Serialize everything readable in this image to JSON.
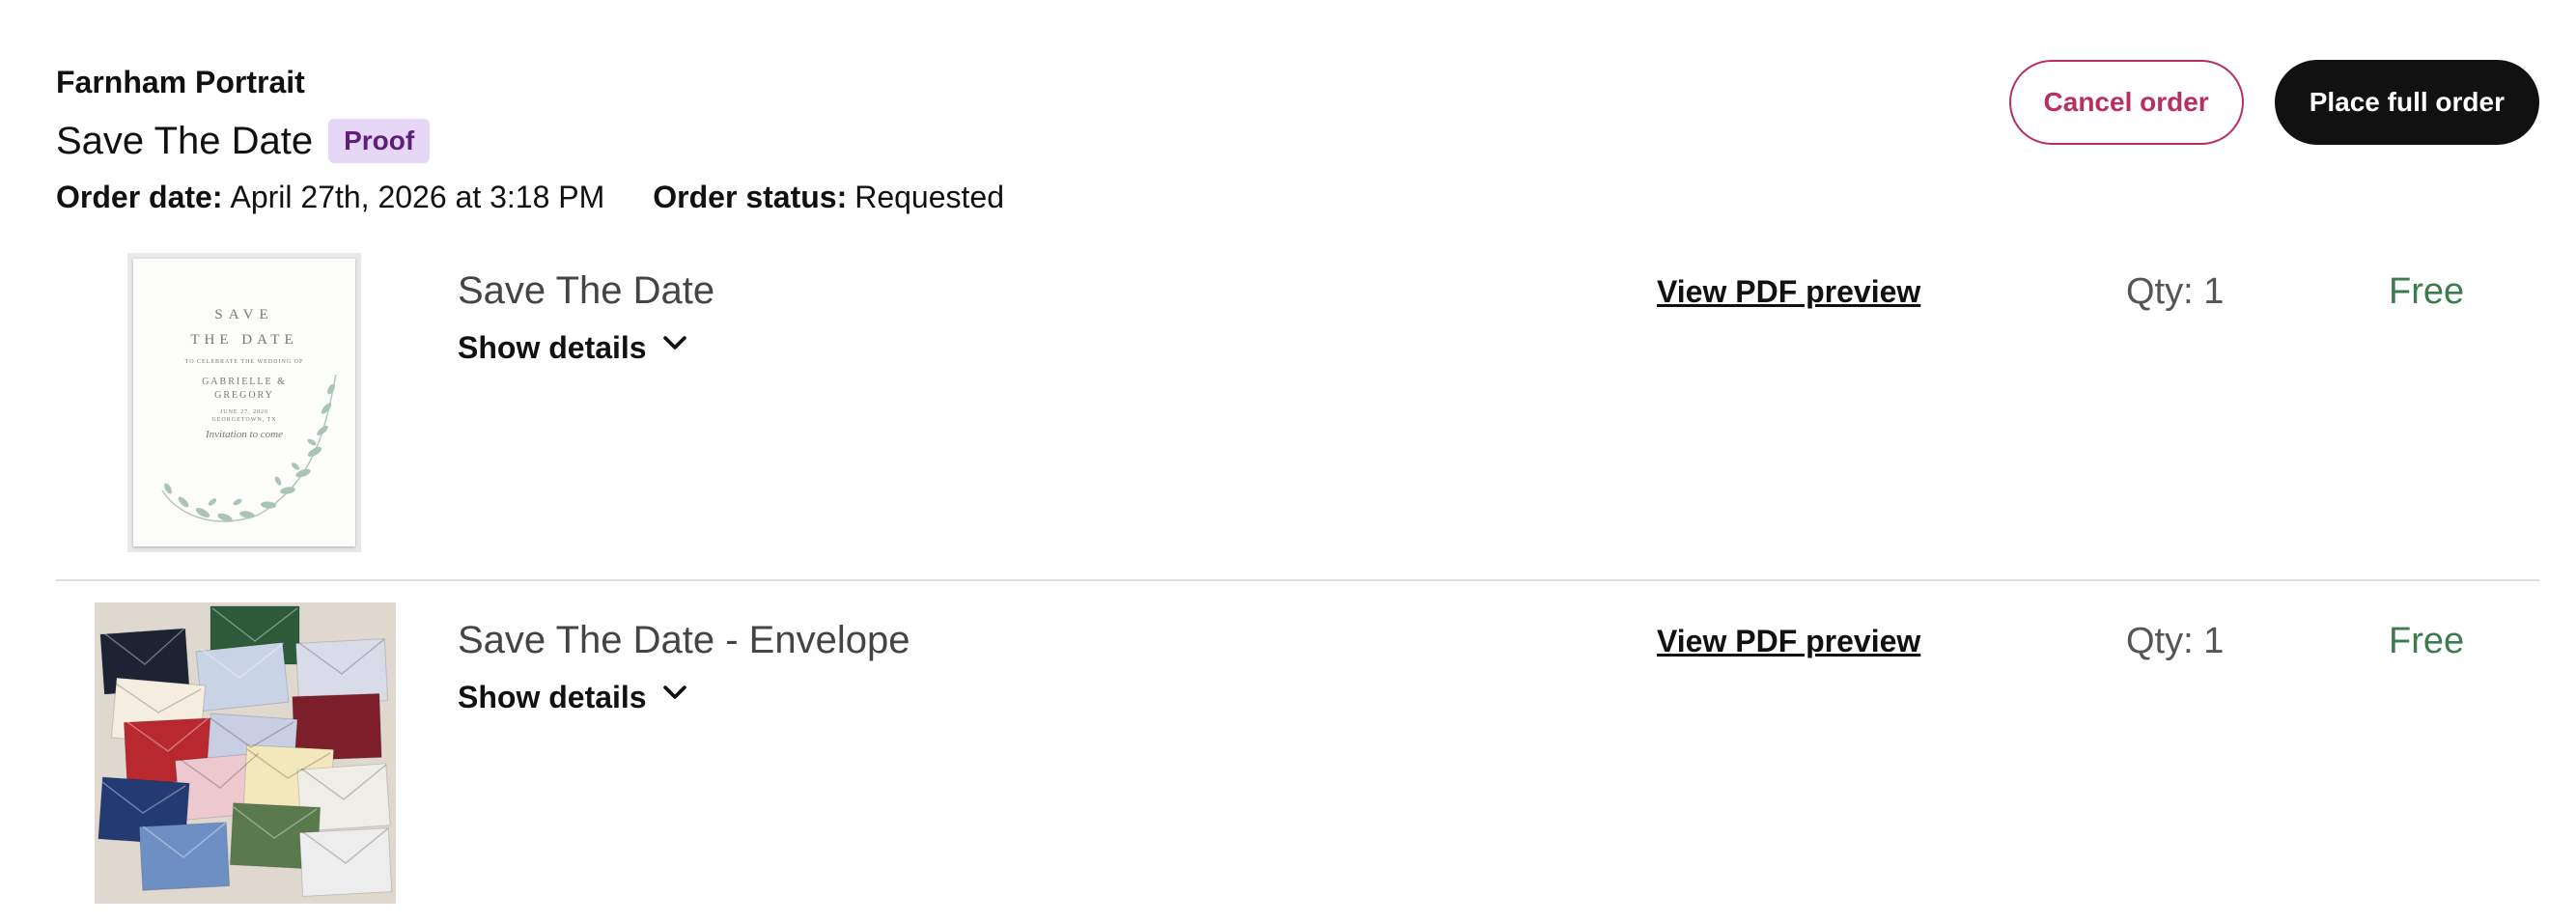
{
  "header": {
    "brand": "Farnham Portrait",
    "title": "Save The Date",
    "badge": "Proof",
    "order_date_label": "Order date:",
    "order_date_value": "April 27th, 2026 at 3:18 PM",
    "order_status_label": "Order status:",
    "order_status_value": "Requested"
  },
  "actions": {
    "cancel_label": "Cancel order",
    "place_label": "Place full order"
  },
  "items": [
    {
      "name": "Save The Date",
      "details_label": "Show details",
      "pdf_label": "View PDF preview",
      "qty": "Qty: 1",
      "price": "Free",
      "thumb": {
        "line1": "SAVE",
        "line2": "THE DATE",
        "line3": "TO CELEBRATE THE WEDDING OF",
        "line4": "GABRIELLE &",
        "line5": "GREGORY",
        "line6": "JUNE 27, 2026",
        "line7": "GEORGETOWN, TX",
        "line8": "Invitation to come"
      }
    },
    {
      "name": "Save The Date - Envelope",
      "details_label": "Show details",
      "pdf_label": "View PDF preview",
      "qty": "Qty: 1",
      "price": "Free"
    }
  ],
  "colors": {
    "badge_bg": "#e6d7f7",
    "badge_text": "#5e1f76",
    "cancel": "#b8305d",
    "primary": "#111111",
    "price": "#3e7b4e",
    "envelopes": [
      "#1c2333",
      "#2d5b3a",
      "#c9d3e6",
      "#d9dce8",
      "#f4ede0",
      "#c8cfe3",
      "#b8282f",
      "#7d1f2b",
      "#edc9cf",
      "#f3e8bb",
      "#eeeee6",
      "#243a72",
      "#6e8fc4",
      "#5a7a4e",
      "#ededee"
    ]
  },
  "icons": {
    "details_chevron": "chevron-down-icon"
  }
}
